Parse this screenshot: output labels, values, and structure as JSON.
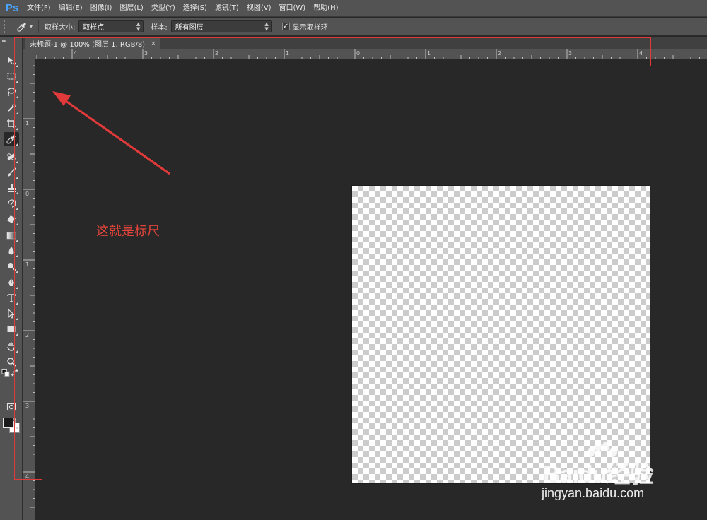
{
  "app": {
    "logo": "Ps",
    "brand_color": "#4aa3ff"
  },
  "menu": [
    {
      "label": "文件(F)"
    },
    {
      "label": "编辑(E)"
    },
    {
      "label": "图像(I)"
    },
    {
      "label": "图层(L)"
    },
    {
      "label": "类型(Y)"
    },
    {
      "label": "选择(S)"
    },
    {
      "label": "滤镜(T)"
    },
    {
      "label": "视图(V)"
    },
    {
      "label": "窗口(W)"
    },
    {
      "label": "帮助(H)"
    }
  ],
  "options_bar": {
    "tool_icon": "eyedropper-icon",
    "sample_size_label": "取样大小:",
    "sample_size_value": "取样点",
    "sample_label": "样本:",
    "sample_value": "所有图层",
    "show_ring_label": "显示取样环",
    "show_ring_checked": true
  },
  "document": {
    "tab_title": "未标题-1 @ 100% (图层 1, RGB/8)",
    "close_label": "×"
  },
  "rulers": {
    "horizontal_labels": [
      "4",
      "3",
      "2",
      "1",
      "0",
      "1",
      "2",
      "3",
      "4"
    ],
    "vertical_labels": [
      "1",
      "0",
      "1",
      "2",
      "3",
      "4"
    ]
  },
  "tools": [
    {
      "name": "move-tool-icon"
    },
    {
      "name": "marquee-tool-icon"
    },
    {
      "name": "lasso-tool-icon"
    },
    {
      "name": "quick-selection-tool-icon"
    },
    {
      "name": "crop-tool-icon"
    },
    {
      "name": "eyedropper-tool-icon",
      "active": true
    },
    {
      "name": "healing-brush-tool-icon"
    },
    {
      "name": "brush-tool-icon"
    },
    {
      "name": "clone-stamp-tool-icon"
    },
    {
      "name": "history-brush-tool-icon"
    },
    {
      "name": "eraser-tool-icon"
    },
    {
      "name": "gradient-tool-icon"
    },
    {
      "name": "blur-tool-icon"
    },
    {
      "name": "dodge-tool-icon"
    },
    {
      "name": "pen-tool-icon"
    },
    {
      "name": "type-tool-icon"
    },
    {
      "name": "path-selection-tool-icon"
    },
    {
      "name": "rectangle-tool-icon"
    },
    {
      "name": "hand-tool-icon"
    },
    {
      "name": "zoom-tool-icon"
    }
  ],
  "annotation": {
    "text": "这就是标尺",
    "color": "#e23a3a"
  },
  "watermark": {
    "brand": "Baidu经验",
    "url": "jingyan.baidu.com"
  }
}
